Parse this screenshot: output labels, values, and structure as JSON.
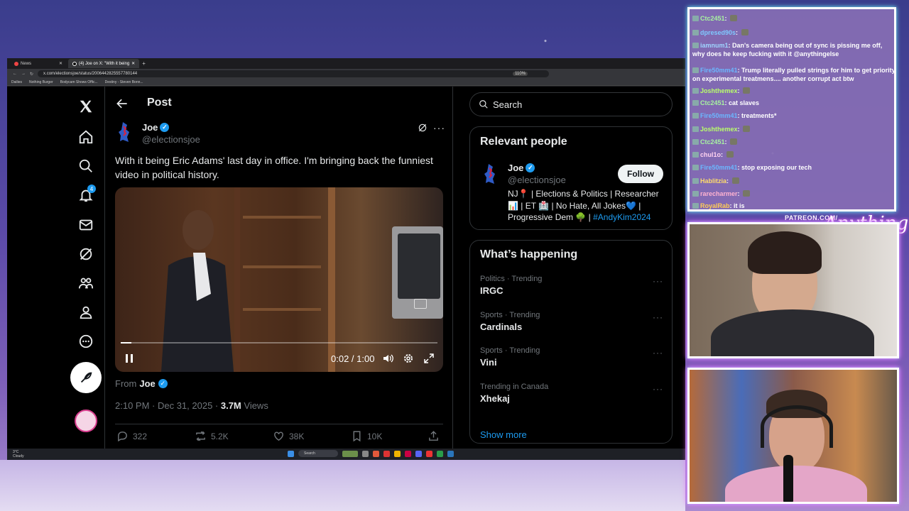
{
  "browser": {
    "tabs": [
      {
        "label": "News",
        "active": false
      },
      {
        "label": "(4) Joe on X: \"With it being",
        "active": true
      }
    ],
    "url": "x.com/electionsjoe/status/2006442825557780144",
    "zoom": "110%",
    "bookmarks": [
      "Dailies",
      "Nothing Burger",
      "Bodycam Shows Offic...",
      "Destiny - Steven Bonn..."
    ]
  },
  "taskbar": {
    "weather_temp": "3°C",
    "weather_desc": "Cloudy",
    "search_label": "Search"
  },
  "nav": {
    "notifications_count": "4"
  },
  "post": {
    "header_title": "Post",
    "author_name": "Joe",
    "author_handle": "@electionsjoe",
    "text": "With it being Eric Adams' last day in office. I'm bringing back the funniest video in political history.",
    "video_time": "0:02 / 1:00",
    "video_progress": 0.033,
    "from_label": "From",
    "from_name": "Joe",
    "timestamp": "2:10 PM · Dec 31, 2025 · ",
    "views_count": "3.7M",
    "views_label": " Views",
    "replies": "322",
    "reposts": "5.2K",
    "likes": "38K",
    "bookmarks": "10K"
  },
  "sidebar": {
    "search_placeholder": "Search",
    "relevant_title": "Relevant people",
    "rp_name": "Joe",
    "rp_handle": "@electionsjoe",
    "follow_label": "Follow",
    "rp_bio": "NJ📍 | Elections & Politics | Researcher 📊 | ET 🏥 | No Hate, All Jokes💙 | Progressive Dem 🌳 | ",
    "rp_bio_hashtag": "#AndyKim2024",
    "happening_title": "What’s happening",
    "trends": [
      {
        "context": "Politics · Trending",
        "name": "IRGC"
      },
      {
        "context": "Sports · Trending",
        "name": "Cardinals"
      },
      {
        "context": "Sports · Trending",
        "name": "Vini"
      },
      {
        "context": "Trending in Canada",
        "name": "Xhekaj"
      }
    ],
    "show_more": "Show more"
  },
  "chat": {
    "messages": [
      {
        "user": "Ctc2451",
        "text": "",
        "color": "#a7f3a0"
      },
      {
        "user": "dpresed90s",
        "text": "",
        "color": "#7fc9ff"
      },
      {
        "user": "iamnum1",
        "text": "Dan's camera being out of sync is pissing me off, why does he keep fucking with it @anythingelse",
        "color": "#9fd5ff"
      },
      {
        "user": "Fire50mm41",
        "text": "Trump literally pulled strings for him to get priority on experimental treatmens.... another corrupt act btw",
        "color": "#6bb7ff"
      },
      {
        "user": "Joshthemex",
        "text": "",
        "color": "#b9ff6a"
      },
      {
        "user": "Ctc2451",
        "text": "cat slaves",
        "color": "#a7f3a0"
      },
      {
        "user": "Fire50mm41",
        "text": "treatments*",
        "color": "#6bb7ff"
      },
      {
        "user": "Joshthemex",
        "text": "",
        "color": "#b9ff6a"
      },
      {
        "user": "Ctc2451",
        "text": "",
        "color": "#a7f3a0"
      },
      {
        "user": "chul1o",
        "text": "",
        "color": "#ffd2f0"
      },
      {
        "user": "Fire50mm41",
        "text": "stop exposing our tech",
        "color": "#6bb7ff"
      },
      {
        "user": "Hablitzia",
        "text": "",
        "color": "#ffdc6b"
      },
      {
        "user": "rarecharmer",
        "text": "",
        "color": "#ffb3d1"
      },
      {
        "user": "RoyalRab",
        "text": "it is",
        "color": "#ffcc55"
      }
    ]
  },
  "overlay": {
    "patreon": "PATREON.COM/",
    "brand_script": "Anything Else"
  }
}
